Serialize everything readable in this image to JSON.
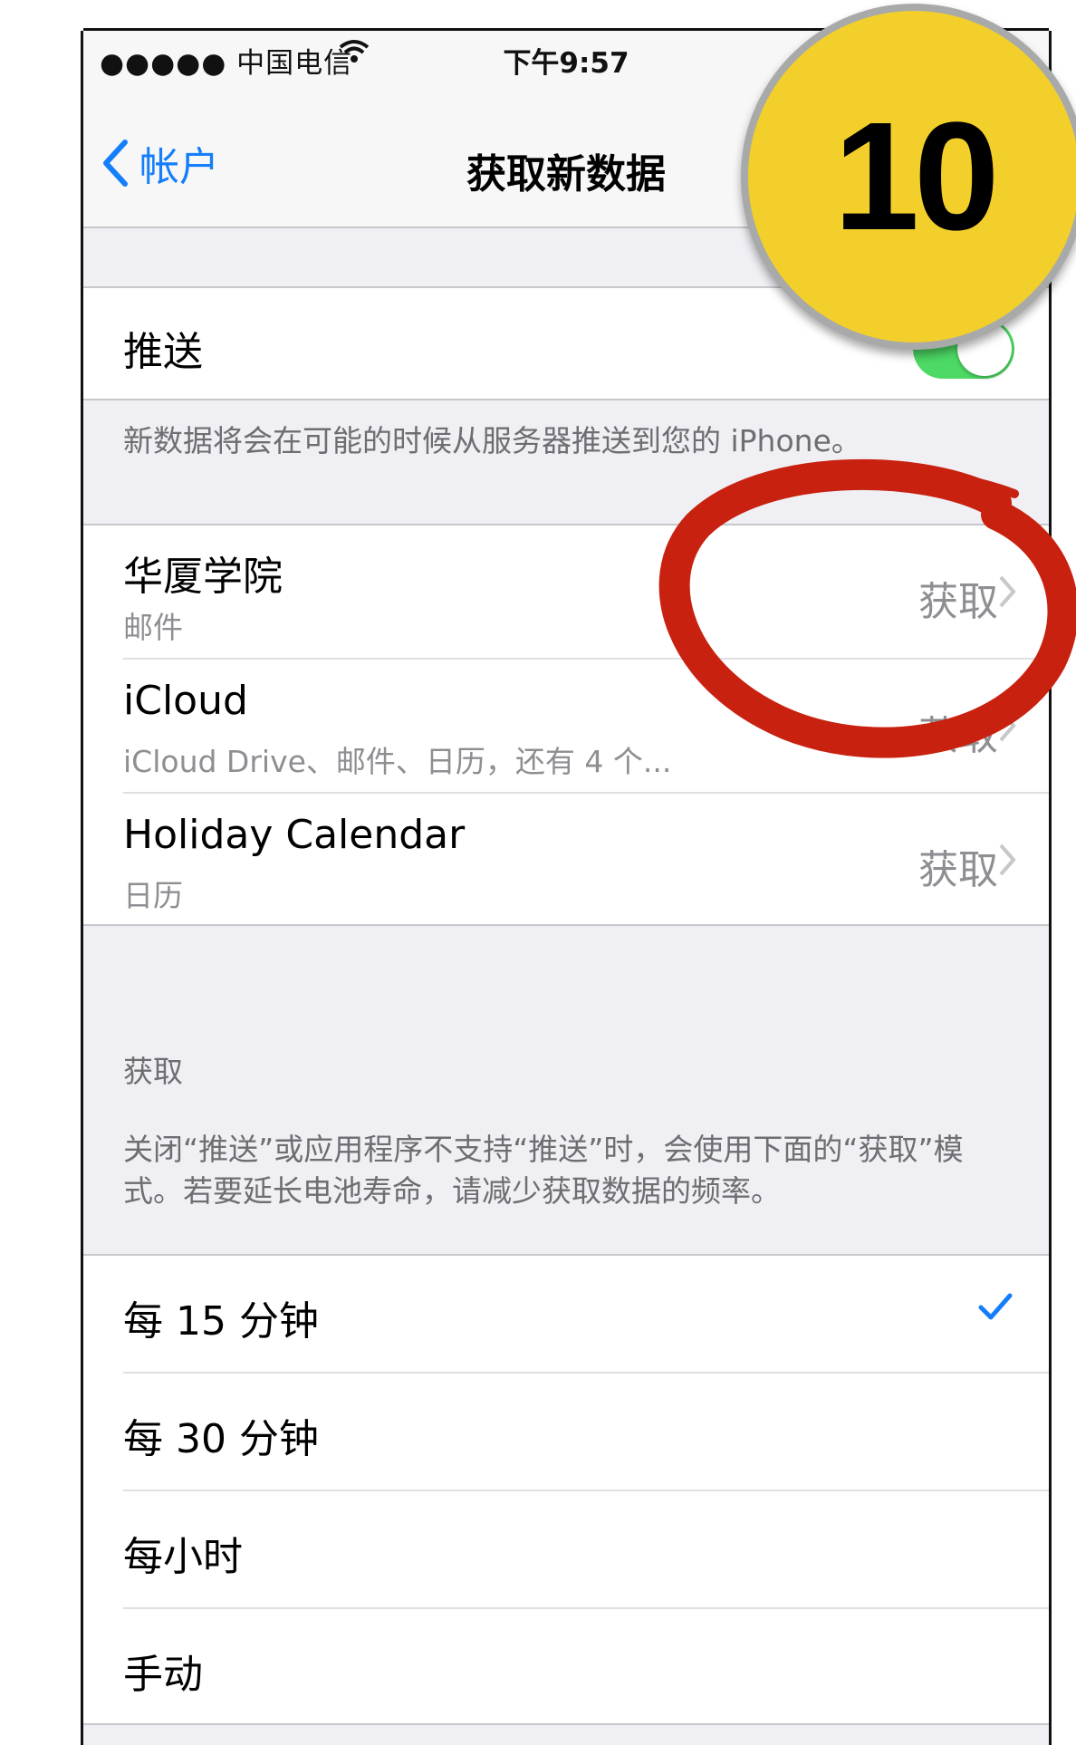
{
  "status": {
    "carrier": "●●●●● 中国电信",
    "time": "下午9:57"
  },
  "nav": {
    "back_label": "帐户",
    "title": "获取新数据"
  },
  "push": {
    "label": "推送",
    "enabled": true,
    "note": "新数据将会在可能的时候从服务器推送到您的 iPhone。"
  },
  "accounts": [
    {
      "name": "华厦学院",
      "services": "邮件",
      "mode": "获取"
    },
    {
      "name": "iCloud",
      "services": "iCloud Drive、邮件、日历，还有 4 个...",
      "mode": "获取"
    },
    {
      "name": "Holiday Calendar",
      "services": "日历",
      "mode": "获取"
    }
  ],
  "fetch": {
    "header": "获取",
    "note": "关闭“推送”或应用程序不支持“推送”时，会使用下面的“获取”模式。若要延长电池寿命，请减少获取数据的频率。",
    "options": [
      "每 15 分钟",
      "每 30 分钟",
      "每小时",
      "手动"
    ],
    "selected": "每 15 分钟"
  },
  "overlay": {
    "step_badge": "10"
  },
  "colors": {
    "accent": "#157efb",
    "toggle_on": "#4cd964",
    "badge": "#f3cf2c",
    "annotation": "#c8210f"
  }
}
